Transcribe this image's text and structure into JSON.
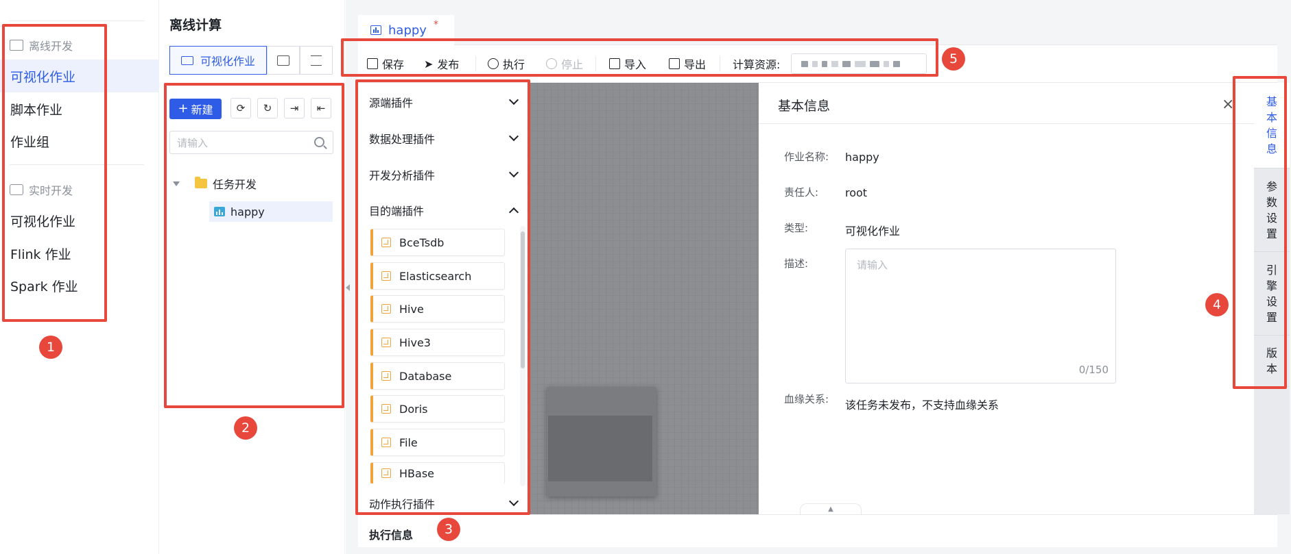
{
  "nav": {
    "group_offline": "离线开发",
    "offline_items": [
      "可视化作业",
      "脚本作业",
      "作业组"
    ],
    "group_realtime": "实时开发",
    "realtime_items": [
      "可视化作业",
      "Flink 作业",
      "Spark 作业"
    ]
  },
  "tree": {
    "title": "离线计算",
    "seg_visual": "可视化作业",
    "new_button": "新建",
    "search_placeholder": "请输入",
    "folder": "任务开发",
    "leaf": "happy"
  },
  "tab": {
    "label": "happy",
    "modified_mark": "*"
  },
  "toolbar": {
    "save": "保存",
    "publish": "发布",
    "run": "执行",
    "stop": "停止",
    "import": "导入",
    "export": "导出",
    "resource_label": "计算资源:"
  },
  "plugins": {
    "groups": [
      "源端插件",
      "数据处理插件",
      "开发分析插件",
      "目的端插件"
    ],
    "target_items": [
      "BceTsdb",
      "Elasticsearch",
      "Hive",
      "Hive3",
      "Database",
      "Doris",
      "File",
      "HBase"
    ],
    "action_group": "动作执行插件"
  },
  "info": {
    "title": "基本信息",
    "close": "×",
    "name_label": "作业名称:",
    "name_value": "happy",
    "owner_label": "责任人:",
    "owner_value": "root",
    "type_label": "类型:",
    "type_value": "可视化作业",
    "desc_label": "描述:",
    "desc_placeholder": "请输入",
    "desc_counter": "0/150",
    "lineage_label": "血缘关系:",
    "lineage_value": "该任务未发布，不支持血缘关系"
  },
  "right_tabs": [
    "基本信息",
    "参数设置",
    "引擎设置",
    "版本"
  ],
  "exec": {
    "title": "执行信息"
  },
  "annotations": [
    "1",
    "2",
    "3",
    "4",
    "5"
  ],
  "colors": {
    "accent": "#2e5ce6",
    "annotation": "#e8483b",
    "plugin": "#f0a33a"
  }
}
